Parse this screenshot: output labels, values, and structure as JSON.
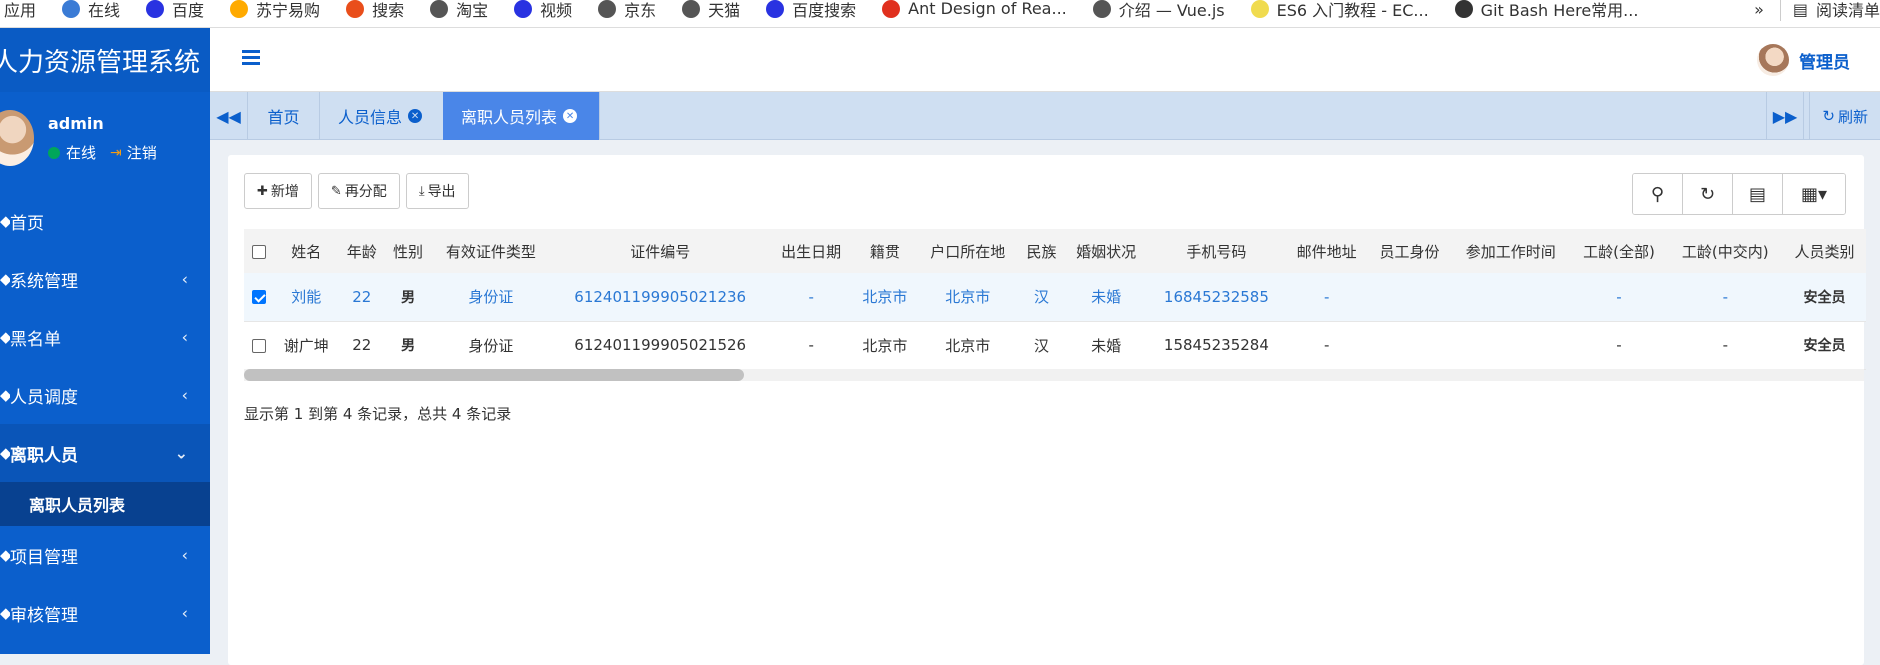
{
  "bookmarks": {
    "items": [
      {
        "label": "应用",
        "icon": "apps-icon",
        "color": ""
      },
      {
        "label": "在线",
        "icon": "online-icon",
        "color": "#3a7bd5"
      },
      {
        "label": "百度",
        "icon": "baidu-icon",
        "color": "#2932e1"
      },
      {
        "label": "苏宁易购",
        "icon": "suning-icon",
        "color": "#ffaa00"
      },
      {
        "label": "搜索",
        "icon": "search-engine-icon",
        "color": "#e94e1b"
      },
      {
        "label": "淘宝",
        "icon": "globe-icon",
        "color": "#555555"
      },
      {
        "label": "视频",
        "icon": "baidu-icon",
        "color": "#2932e1"
      },
      {
        "label": "京东",
        "icon": "globe-icon",
        "color": "#555555"
      },
      {
        "label": "天猫",
        "icon": "globe-icon",
        "color": "#555555"
      },
      {
        "label": "百度搜索",
        "icon": "baidu-icon",
        "color": "#2932e1"
      },
      {
        "label": "Ant Design of Rea...",
        "icon": "ant-design-icon",
        "color": "#e0301e"
      },
      {
        "label": "介绍 — Vue.js",
        "icon": "globe-icon",
        "color": "#555555"
      },
      {
        "label": "ES6 入门教程 - EC...",
        "icon": "es-icon",
        "color": "#f0db4f"
      },
      {
        "label": "Git Bash Here常用...",
        "icon": "git-icon",
        "color": "#333333"
      }
    ],
    "more": "»",
    "reading_list": "阅读清单"
  },
  "app": {
    "title": "人力资源管理系统"
  },
  "user": {
    "name": "admin",
    "status": "在线",
    "signout": "注销"
  },
  "header": {
    "admin_label": "管理员"
  },
  "sidebar": {
    "items": [
      {
        "label": "首页"
      },
      {
        "label": "系统管理"
      },
      {
        "label": "黑名单"
      },
      {
        "label": "人员调度"
      },
      {
        "label": "离职人员"
      },
      {
        "label": "项目管理"
      },
      {
        "label": "审核管理"
      }
    ],
    "submenu": "离职人员列表"
  },
  "tabs": {
    "items": [
      {
        "label": "首页"
      },
      {
        "label": "人员信息"
      },
      {
        "label": "离职人员列表"
      }
    ],
    "refresh": "刷新"
  },
  "toolbar": {
    "add": "新增",
    "reassign": "再分配",
    "export": "导出"
  },
  "table": {
    "columns": [
      "姓名",
      "年龄",
      "性别",
      "有效证件类型",
      "证件编号",
      "出生日期",
      "籍贯",
      "户口所在地",
      "民族",
      "婚姻状况",
      "手机号码",
      "邮件地址",
      "员工身份",
      "参加工作时间",
      "工龄(全部)",
      "工龄(中交内)",
      "人员类别"
    ],
    "rows": [
      {
        "checked": true,
        "cells": [
          "刘能",
          "22",
          "男",
          "身份证",
          "612401199905021236",
          "-",
          "北京市",
          "北京市",
          "汉",
          "未婚",
          "16845232585",
          "-",
          "",
          "",
          "-",
          "-",
          "安全员"
        ]
      },
      {
        "checked": false,
        "cells": [
          "谢广坤",
          "22",
          "男",
          "身份证",
          "612401199905021526",
          "-",
          "北京市",
          "北京市",
          "汉",
          "未婚",
          "15845235284",
          "-",
          "",
          "",
          "-",
          "-",
          "安全员"
        ]
      }
    ]
  },
  "pagination": {
    "info": "显示第 1 到第 4 条记录，总共 4 条记录"
  },
  "colors": {
    "sidebar": "#0b5fcc",
    "active_tab": "#4a86e8",
    "link": "#2a78d4"
  }
}
